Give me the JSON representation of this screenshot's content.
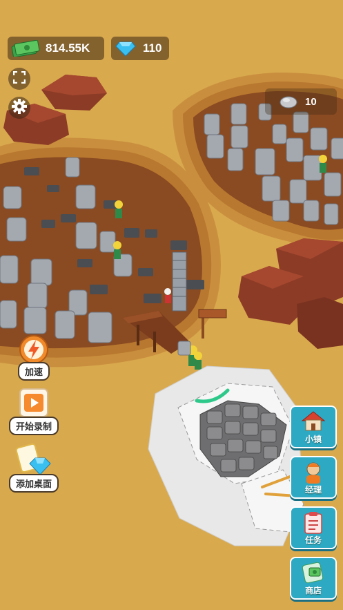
{
  "hud": {
    "cash": {
      "icon": "cash-icon",
      "value": "814.55K"
    },
    "gems": {
      "icon": "diamond-icon",
      "value": "110"
    },
    "stone_counter": {
      "icon": "stone-icon",
      "value": "10"
    }
  },
  "top_buttons": [
    {
      "icon": "fullscreen-icon"
    },
    {
      "icon": "gear-icon"
    }
  ],
  "left_buttons": [
    {
      "label": "加速",
      "icon": "speed-up-icon"
    },
    {
      "label": "开始录制",
      "icon": "record-icon"
    },
    {
      "label": "添加桌面",
      "icon": "add-desktop-icon"
    }
  ],
  "right_buttons": [
    {
      "label": "小镇",
      "icon": "town-house-icon"
    },
    {
      "label": "经理",
      "icon": "manager-icon"
    },
    {
      "label": "任务",
      "icon": "task-clipboard-icon"
    },
    {
      "label": "商店",
      "icon": "shop-icon"
    }
  ],
  "colors": {
    "ground": "#d9a94e",
    "pit_floor": "#8a4a22",
    "rock_red": "#8c3b26",
    "stone_gray": "#a4a9b0",
    "button_blue": "#2ea9c4"
  }
}
